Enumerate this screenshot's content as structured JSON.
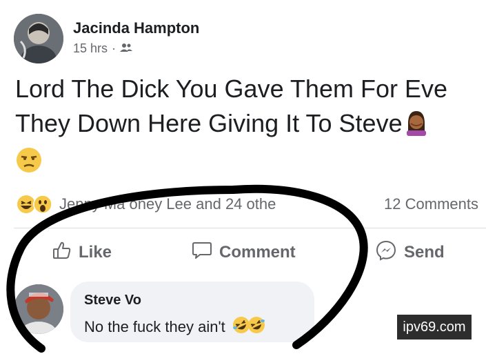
{
  "post": {
    "author": "Jacinda Hampton",
    "time": "15 hrs",
    "separator": "·",
    "audience_icon": "friends-icon",
    "text_line1": "Lord The Dick You Gave Them For Eve",
    "text_line2": "They Down Here Giving It To Steve",
    "text_emoji": "woman-facepalming-emoji",
    "extra_emoji": "unamused-face-emoji"
  },
  "reactions": {
    "icons": [
      "haha-reaction-icon",
      "wow-reaction-icon"
    ],
    "names": "Jenny Ma  oney Lee and 24 othe",
    "comments_count": "12 Comments"
  },
  "actions": {
    "like_label": "Like",
    "comment_label": "Comment",
    "send_label": "Send"
  },
  "comment": {
    "author": "Steve Vo",
    "text": "No the fuck they ain't",
    "emojis": [
      "rolling-on-floor-laughing-emoji",
      "rolling-on-floor-laughing-emoji"
    ]
  },
  "watermark": {
    "text": "ipv69.com"
  },
  "colors": {
    "text_primary": "#1c1e21",
    "text_secondary": "#65676b",
    "bubble_bg": "#f0f2f5",
    "annotation": "#000000"
  }
}
